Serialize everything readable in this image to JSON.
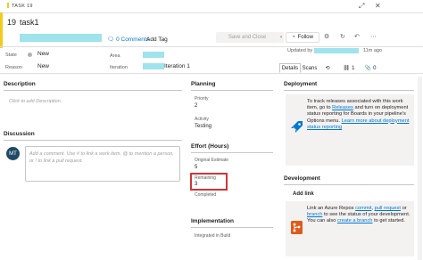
{
  "header": {
    "type_label": "TASK 19",
    "id": "19",
    "title": "task1"
  },
  "toolbar": {
    "comments_label": "0 Comments",
    "add_tag_label": "Add Tag",
    "save_label": "Save and Close",
    "follow_label": "Follow",
    "updated_label": "Updated by",
    "updated_time": "11m ago"
  },
  "fields": {
    "state_label": "State",
    "state_value": "New",
    "reason_label": "Reason",
    "reason_value": "New",
    "area_label": "Area",
    "iteration_label": "Iteration",
    "iteration_value": "Iteration 1"
  },
  "tabs": {
    "details": "Details",
    "scans": "Scans",
    "links_count": "1",
    "attachments_count": "0"
  },
  "description": {
    "title": "Description",
    "placeholder": "Click to add Description."
  },
  "discussion": {
    "title": "Discussion",
    "avatar_initials": "MT",
    "placeholder_line1": "Add a comment. Use # to link a work item, @ to mention a person,",
    "placeholder_line2": "or ! to link a pull request."
  },
  "planning": {
    "title": "Planning",
    "priority_label": "Priority",
    "priority_value": "2",
    "activity_label": "Activity",
    "activity_value": "Testing"
  },
  "effort": {
    "title": "Effort (Hours)",
    "original_label": "Original Estimate",
    "original_value": "5",
    "remaining_label": "Remaining",
    "remaining_value": "3",
    "completed_label": "Completed"
  },
  "implementation": {
    "title": "Implementation",
    "integrated_label": "Integrated in Build"
  },
  "deployment": {
    "title": "Deployment",
    "text_1": "To track releases associated with this work item, go to ",
    "link_releases": "Releases",
    "text_2": " and turn on deployment status reporting for Boards in your pipeline's Options menu. ",
    "link_learn": "Learn more about deployment status reporting"
  },
  "development": {
    "title": "Development",
    "add_link": "Add link",
    "text_1": "Link an Azure Repos ",
    "link_commit": "commit",
    "text_2": ", ",
    "link_pr": "pull request",
    "text_3": " or ",
    "link_branch": "branch",
    "text_4": " to see the status of your development. You can also ",
    "link_create": "create a branch",
    "text_5": " to get started."
  },
  "colors": {
    "accent_yellow": "#f2cb1d",
    "link_blue": "#0078d4",
    "highlight_red": "#d13438",
    "redaction_cyan": "#9fe3ec"
  }
}
